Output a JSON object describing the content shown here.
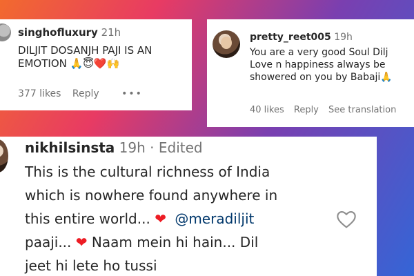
{
  "comments": [
    {
      "username": "singhofluxury",
      "time": "21h",
      "text_line1": "DILJIT DOSANJH PAJI IS AN",
      "text_line2": "EMOTION 🙏😇❤️🙌",
      "likes": "377 likes",
      "reply": "Reply",
      "more": "•••"
    },
    {
      "username": "pretty_reet005",
      "time": "19h",
      "text_line1": "You are a very good Soul Dilj",
      "text_line2": "Love n happiness always be",
      "text_line3": "showered on you by Babaji🙏",
      "likes": "40 likes",
      "reply": "Reply",
      "see_translation": "See translation"
    },
    {
      "username": "nikhilsinsta",
      "time_edited": "19h · Edited",
      "text_line1": "This is the cultural richness of India",
      "text_line2": "which is nowhere found anywhere in",
      "text_line3_a": "this entire world...",
      "text_line3_heart": "❤",
      "mention": "@meradiljit",
      "text_line4_a": "paaji...",
      "text_line4_heart": "❤",
      "text_line4_b": "Naam mein hi hain... Dil",
      "text_line5": "jeet hi lete ho tussi"
    }
  ],
  "colors": {
    "heart": "#ed1c24",
    "mention": "#00376b",
    "muted": "#737373"
  },
  "icons": [
    "heart-outline-icon",
    "more-options-icon"
  ]
}
